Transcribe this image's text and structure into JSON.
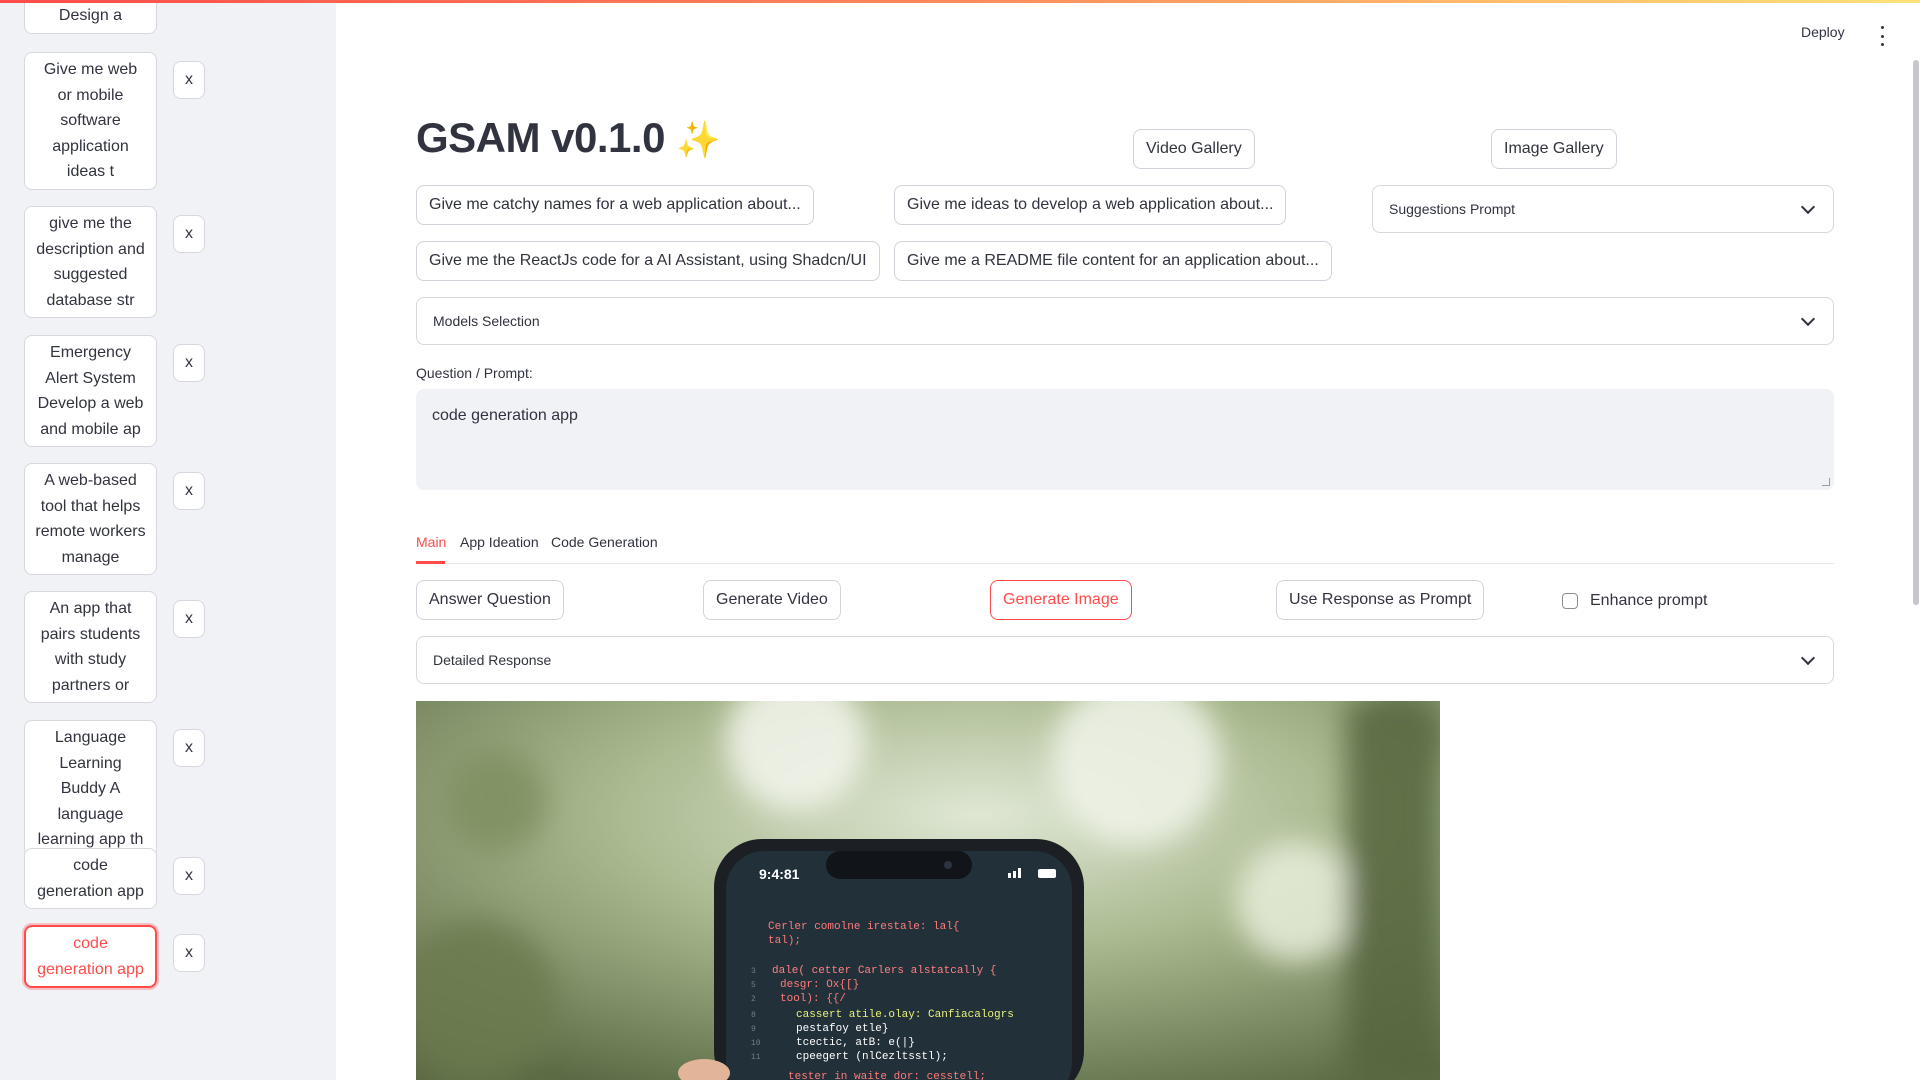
{
  "header": {
    "deploy_label": "Deploy"
  },
  "sidebar": {
    "history": [
      {
        "label": "Design a",
        "remove_label": ""
      },
      {
        "label": "Give me web or mobile software application ideas t",
        "remove_label": "x"
      },
      {
        "label": "give me the description and suggested database str",
        "remove_label": "x"
      },
      {
        "label": "Emergency Alert System Develop a web and mobile ap",
        "remove_label": "x"
      },
      {
        "label": "A web-based tool that helps remote workers manage",
        "remove_label": "x"
      },
      {
        "label": "An app that pairs students with study partners or",
        "remove_label": "x"
      },
      {
        "label": "Language Learning Buddy A language learning app th",
        "remove_label": "x"
      },
      {
        "label": "code generation app",
        "remove_label": "x"
      },
      {
        "label": "code generation app",
        "remove_label": "x"
      }
    ]
  },
  "main": {
    "title": "GSAM v0.1.0",
    "title_emoji": "✨",
    "gallery_buttons": {
      "video": "Video Gallery",
      "image": "Image Gallery"
    },
    "prompt_suggestions": [
      "Give me catchy names for a web application about...",
      "Give me ideas to develop a web application about...",
      "Give me the ReactJs code for a AI Assistant, using Shadcn/UI",
      "Give me a README file content for an application about..."
    ],
    "suggestions_dropdown": "Suggestions Prompt",
    "models_expander": "Models Selection",
    "prompt_label": "Question / Prompt:",
    "prompt_value": "code generation app",
    "tabs": [
      "Main",
      "App Ideation",
      "Code Generation"
    ],
    "actions": {
      "answer": "Answer Question",
      "video": "Generate Video",
      "image": "Generate Image",
      "use_response": "Use Response as Prompt",
      "enhance": "Enhance prompt"
    },
    "detailed_expander": "Detailed Response",
    "image": {
      "phone_time": "9:4:81",
      "code_lines": [
        "Cerler comolne irestale: lal{",
        "tal);",
        "dale( cetter Carlers alstatcally {",
        "desgr: Ox{[}",
        "tool): {{/",
        "cassert atile.olay: Canfiacalogrs",
        "pestafoy etle}",
        "tcectic, atB:    e(|}",
        "cpeegert (nlCezltsstl);",
        "tester in waite dor: cesstell;"
      ]
    }
  },
  "colors": {
    "accent": "#ff4b4b",
    "sidebar_bg": "#f0f2f6"
  }
}
